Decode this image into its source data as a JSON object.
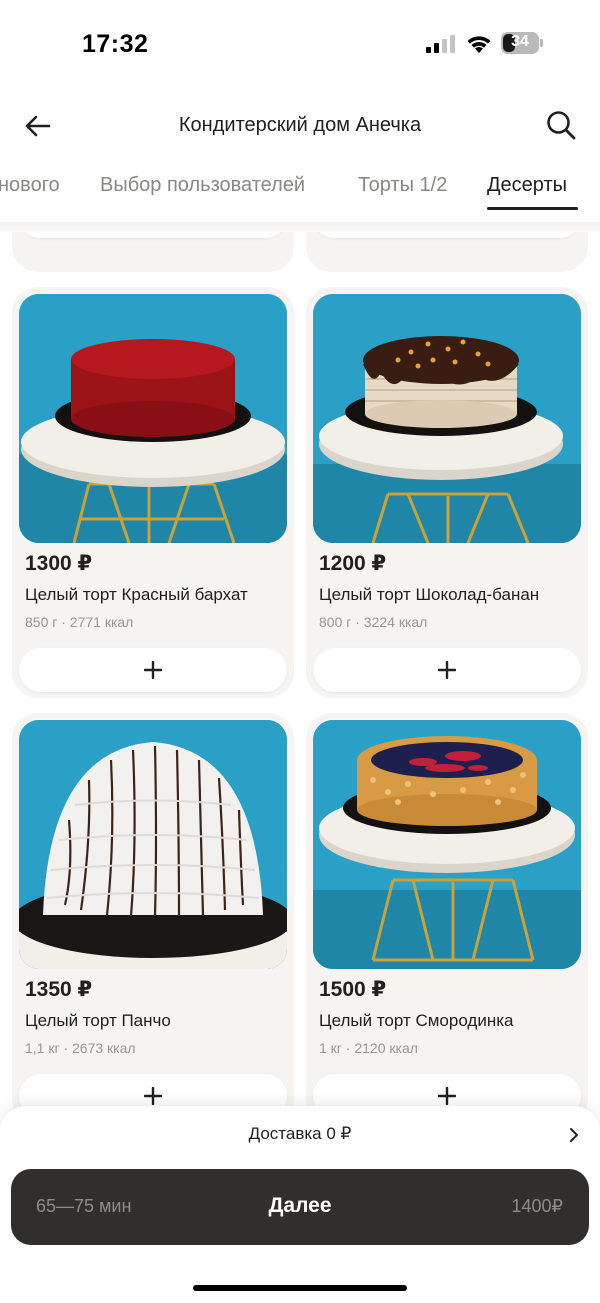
{
  "status_bar": {
    "time": "17:32",
    "battery": "34",
    "battery_level": 0.34
  },
  "header": {
    "title": "Кондитерский дом Анечка"
  },
  "tabs": [
    {
      "label": "нового",
      "active": false
    },
    {
      "label": "Выбор пользователей",
      "active": false
    },
    {
      "label": "Торты 1/2",
      "active": false
    },
    {
      "label": "Десерты",
      "active": true
    }
  ],
  "products": [
    {
      "price": "1300 ₽",
      "name": "Целый торт Красный бархат",
      "meta": "850 г · 2771 ккал",
      "image": "red-velvet-cake"
    },
    {
      "price": "1200 ₽",
      "name": "Целый торт Шоколад-банан",
      "meta": "800 г · 3224 ккал",
      "image": "chocolate-banana-cake"
    },
    {
      "price": "1350 ₽",
      "name": "Целый торт Панчо",
      "meta": "1,1 кг · 2673 ккал",
      "image": "pancho-cake"
    },
    {
      "price": "1500 ₽",
      "name": "Целый торт Смородинка",
      "meta": "1 кг · 2120 ккал",
      "image": "currant-cake"
    }
  ],
  "add_symbol": "+",
  "bottom": {
    "delivery": "Доставка 0 ₽",
    "eta": "65—75 мин",
    "next_label": "Далее",
    "total": "1400₽"
  },
  "colors": {
    "accent_dark": "#302f2d",
    "card_bg": "#f5f4f2",
    "photo_bg": "#2aa0c6"
  }
}
